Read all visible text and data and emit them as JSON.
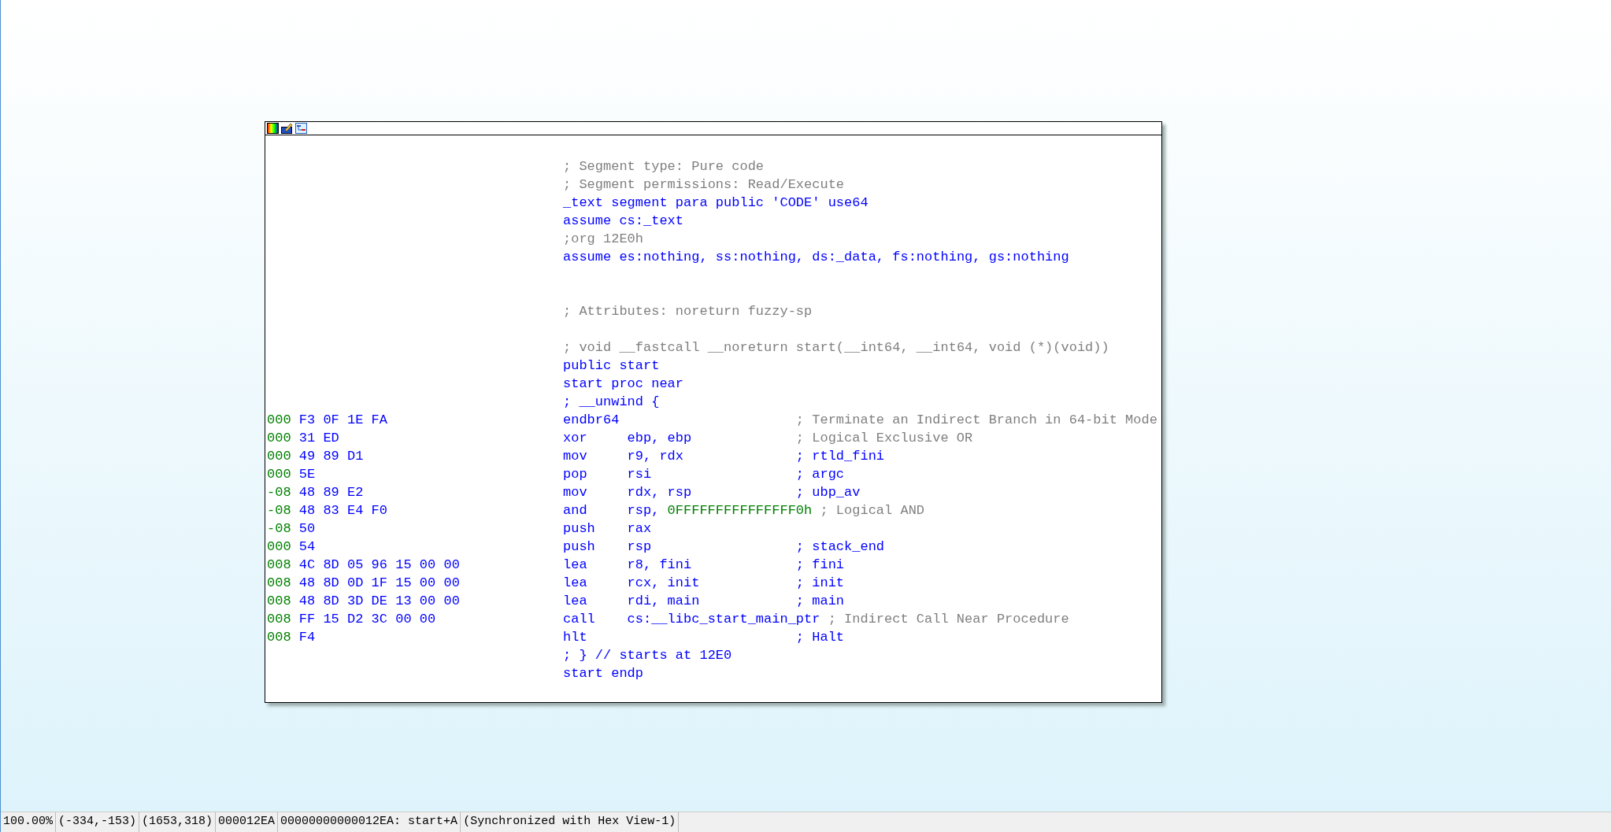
{
  "toolbar": {
    "buttons": [
      {
        "kind": "palette"
      },
      {
        "kind": "pencil"
      },
      {
        "kind": "graph"
      }
    ]
  },
  "listing": [
    {
      "kind": "comment",
      "text": "; Segment type: Pure code"
    },
    {
      "kind": "comment",
      "text": "; Segment permissions: Read/Execute"
    },
    {
      "kind": "directive",
      "text": "_text segment para public 'CODE' use64"
    },
    {
      "kind": "directive",
      "text": "assume cs:_text"
    },
    {
      "kind": "comment",
      "text": ";org 12E0h"
    },
    {
      "kind": "directive",
      "text": "assume es:nothing, ss:nothing, ds:_data, fs:nothing, gs:nothing"
    },
    {
      "kind": "blank"
    },
    {
      "kind": "blank"
    },
    {
      "kind": "comment",
      "text": "; Attributes: noreturn fuzzy-sp"
    },
    {
      "kind": "blank"
    },
    {
      "kind": "comment",
      "text": "; void __fastcall __noreturn start(__int64, __int64, void (*)(void))"
    },
    {
      "kind": "directive",
      "text": "public start"
    },
    {
      "kind": "directive",
      "text": "start proc near"
    },
    {
      "kind": "directive",
      "text": "; __unwind {"
    },
    {
      "kind": "insn",
      "sp": "000",
      "bytes": "F3 0F 1E FA",
      "mnemonic": "endbr64",
      "comment": "; Terminate an Indirect Branch in 64-bit Mode",
      "comment_repeatable": false
    },
    {
      "kind": "insn",
      "sp": "000",
      "bytes": "31 ED",
      "mnemonic": "xor",
      "operands": "ebp, ebp",
      "comment": "; Logical Exclusive OR",
      "comment_repeatable": false
    },
    {
      "kind": "insn",
      "sp": "000",
      "bytes": "49 89 D1",
      "mnemonic": "mov",
      "operands": "r9, rdx",
      "comment": "; rtld_fini",
      "comment_repeatable": true
    },
    {
      "kind": "insn",
      "sp": "000",
      "bytes": "5E",
      "mnemonic": "pop",
      "operands": "rsi",
      "comment": "; argc",
      "comment_repeatable": true
    },
    {
      "kind": "insn",
      "sp": "-08",
      "bytes": "48 89 E2",
      "mnemonic": "mov",
      "operands": "rdx, rsp",
      "comment": "; ubp_av",
      "comment_repeatable": true
    },
    {
      "kind": "insn",
      "sp": "-08",
      "bytes": "48 83 E4 F0",
      "mnemonic": "and",
      "operands": "rsp,",
      "immediate": "0FFFFFFFFFFFFFFF0h",
      "comment": "; Logical AND",
      "comment_repeatable": false
    },
    {
      "kind": "insn",
      "sp": "-08",
      "bytes": "50",
      "mnemonic": "push",
      "operands": "rax"
    },
    {
      "kind": "insn",
      "sp": "000",
      "bytes": "54",
      "mnemonic": "push",
      "operands": "rsp",
      "comment": "; stack_end",
      "comment_repeatable": true
    },
    {
      "kind": "insn",
      "sp": "008",
      "bytes": "4C 8D 05 96 15 00 00",
      "mnemonic": "lea",
      "operands": "r8, fini",
      "comment": "; fini",
      "comment_repeatable": true
    },
    {
      "kind": "insn",
      "sp": "008",
      "bytes": "48 8D 0D 1F 15 00 00",
      "mnemonic": "lea",
      "operands": "rcx, init",
      "comment": "; init",
      "comment_repeatable": true
    },
    {
      "kind": "insn",
      "sp": "008",
      "bytes": "48 8D 3D DE 13 00 00",
      "mnemonic": "lea",
      "operands": "rdi, main",
      "comment": "; main",
      "comment_repeatable": true
    },
    {
      "kind": "insn",
      "sp": "008",
      "bytes": "FF 15 D2 3C 00 00",
      "mnemonic": "call",
      "operands": "cs:__libc_start_main_ptr",
      "comment": "; Indirect Call Near Procedure",
      "comment_repeatable": false
    },
    {
      "kind": "insn",
      "sp": "008",
      "bytes": "F4",
      "mnemonic": "hlt",
      "comment": "; Halt",
      "comment_repeatable": true
    },
    {
      "kind": "directive",
      "text": "; } // starts at 12E0"
    },
    {
      "kind": "directive",
      "text": "start endp"
    }
  ],
  "status_bar": [
    "100.00%",
    "(-334,-153)",
    "(1653,318)",
    "000012EA",
    "00000000000012EA: start+A",
    "(Synchronized with Hex View-1)"
  ]
}
